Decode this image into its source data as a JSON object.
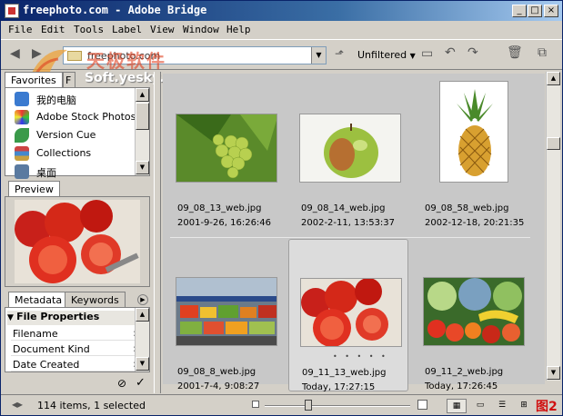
{
  "window": {
    "title": "freephoto.com - Adobe Bridge",
    "controls": [
      "_",
      "□",
      "×"
    ]
  },
  "menu": [
    "File",
    "Edit",
    "Tools",
    "Label",
    "View",
    "Window",
    "Help"
  ],
  "toolbar": {
    "path": "freephoto.com",
    "filter_label": "Unfiltered"
  },
  "watermark": {
    "line1": "天极软件",
    "line2": "Soft.yesky.com"
  },
  "favorites": {
    "tabs": [
      "Favorites",
      "F"
    ],
    "items": [
      {
        "label": "我的电脑",
        "icon": "computer-icon"
      },
      {
        "label": "Adobe Stock Photos",
        "icon": "stock-photos-icon"
      },
      {
        "label": "Version Cue",
        "icon": "version-cue-icon"
      },
      {
        "label": "Collections",
        "icon": "collections-icon"
      },
      {
        "label": "桌面",
        "icon": "desktop-icon"
      }
    ]
  },
  "preview": {
    "tab": "Preview"
  },
  "metadata": {
    "tabs": [
      "Metadata",
      "Keywords"
    ],
    "section": "File Properties",
    "rows": [
      {
        "key": "Filename",
        "value": ":"
      },
      {
        "key": "Document Kind",
        "value": ":"
      },
      {
        "key": "Date Created",
        "value": ":"
      }
    ]
  },
  "thumbnails": [
    {
      "name": "09_08_13_web.jpg",
      "date": "2001-9-26, 16:26:46",
      "subject": "grapes",
      "selected": false
    },
    {
      "name": "09_08_14_web.jpg",
      "date": "2002-2-11, 13:53:37",
      "subject": "apple",
      "selected": false
    },
    {
      "name": "09_08_58_web.jpg",
      "date": "2002-12-18, 20:21:35",
      "subject": "pineapple",
      "selected": false
    },
    {
      "name": "09_08_8_web.jpg",
      "date": "2001-7-4, 9:08:27",
      "subject": "market-stall",
      "selected": false
    },
    {
      "name": "09_11_13_web.jpg",
      "date": "Today, 17:27:15",
      "subject": "tomatoes",
      "selected": true,
      "rating": "• • • • •"
    },
    {
      "name": "09_11_2_web.jpg",
      "date": "Today, 17:26:45",
      "subject": "vegetables",
      "selected": false
    }
  ],
  "status": {
    "text": "114 items, 1 selected",
    "zoom_fraction": 0.3,
    "figure_label": "图2"
  },
  "colors": {
    "titlebar_start": "#0a246a",
    "content_bg": "#c8c8c8",
    "selection_bg": "#dcdcdc"
  }
}
